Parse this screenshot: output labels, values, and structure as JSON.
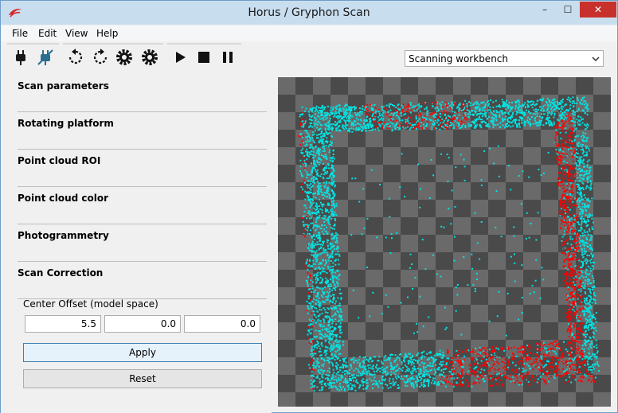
{
  "window": {
    "title": "Horus / Gryphon Scan",
    "minimize": "–",
    "maximize": "☐",
    "close": "✕"
  },
  "menu": [
    "File",
    "Edit",
    "View",
    "Help"
  ],
  "toolbar": {
    "icons": [
      "connect-icon",
      "disconnect-icon",
      "rotate-ccw-icon",
      "rotate-cw-icon",
      "gear-icon",
      "settings-icon",
      "play-icon",
      "stop-icon",
      "pause-icon"
    ],
    "workbench_selected": "Scanning workbench"
  },
  "sections": [
    "Scan parameters",
    "Rotating platform",
    "Point cloud ROI",
    "Point cloud color",
    "Photogrammetry",
    "Scan Correction"
  ],
  "scan_correction": {
    "center_offset_label": "Center Offset (model space)",
    "values": [
      "5.5",
      "0.0",
      "0.0"
    ],
    "apply_label": "Apply",
    "reset_label": "Reset"
  },
  "viewer": {
    "background_checker": [
      "#4a4a4a",
      "#6a6a6a"
    ],
    "point_colors": [
      "#00e5e5",
      "#ff0000"
    ]
  }
}
